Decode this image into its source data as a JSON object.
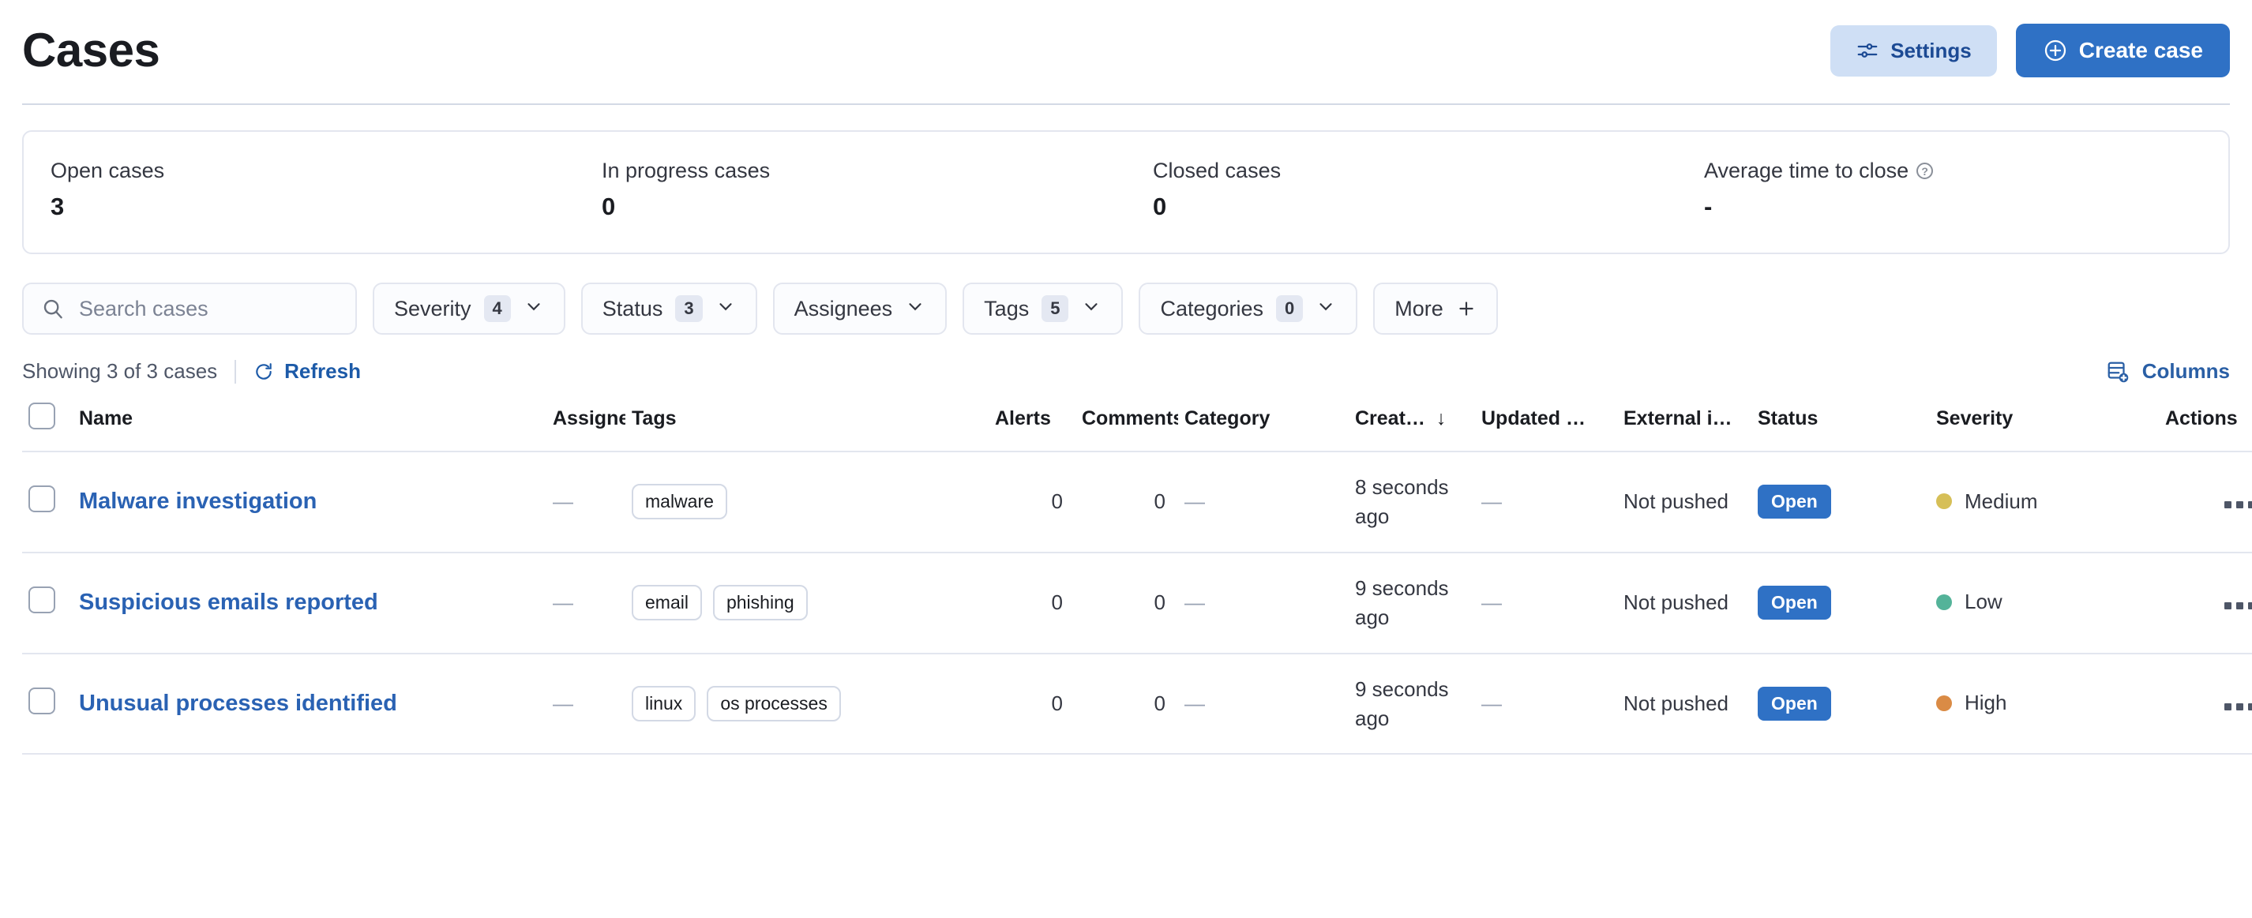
{
  "header": {
    "title": "Cases",
    "settings_label": "Settings",
    "create_label": "Create case",
    "settings_icon": "sliders-icon",
    "create_icon": "plus-circle-icon"
  },
  "stats": [
    {
      "label": "Open cases",
      "value": "3"
    },
    {
      "label": "In progress cases",
      "value": "0"
    },
    {
      "label": "Closed cases",
      "value": "0"
    },
    {
      "label": "Average time to close",
      "value": "-",
      "help": "?"
    }
  ],
  "filters": {
    "search_placeholder": "Search cases",
    "search_value": "",
    "search_icon": "search-icon",
    "buttons": [
      {
        "label": "Severity",
        "count": "4",
        "icon": "chevron-down-icon"
      },
      {
        "label": "Status",
        "count": "3",
        "icon": "chevron-down-icon"
      },
      {
        "label": "Assignees",
        "count": null,
        "icon": "chevron-down-icon"
      },
      {
        "label": "Tags",
        "count": "5",
        "icon": "chevron-down-icon"
      },
      {
        "label": "Categories",
        "count": "0",
        "icon": "chevron-down-icon"
      },
      {
        "label": "More",
        "count": null,
        "icon": "plus-icon"
      }
    ]
  },
  "toolbar": {
    "showing": "Showing 3 of 3 cases",
    "refresh_label": "Refresh",
    "refresh_icon": "refresh-icon",
    "columns_label": "Columns",
    "columns_icon": "table-add-icon"
  },
  "table": {
    "columns": [
      "Name",
      "Assignees",
      "Tags",
      "Alerts",
      "Comments",
      "Category",
      "Creat…",
      "Updated …",
      "External i…",
      "Status",
      "Severity",
      "Actions"
    ],
    "sort": {
      "column": "Creat…",
      "direction": "↓"
    },
    "rows": [
      {
        "name": "Malware investigation",
        "assignees": "—",
        "tags": [
          "malware"
        ],
        "alerts": "0",
        "comments": "0",
        "category": "—",
        "created": "8 seconds ago",
        "updated": "—",
        "external": "Not pushed",
        "status": "Open",
        "severity": "Medium",
        "severity_color": "#d6bf57"
      },
      {
        "name": "Suspicious emails reported",
        "assignees": "—",
        "tags": [
          "email",
          "phishing"
        ],
        "alerts": "0",
        "comments": "0",
        "category": "—",
        "created": "9 seconds ago",
        "updated": "—",
        "external": "Not pushed",
        "status": "Open",
        "severity": "Low",
        "severity_color": "#54b399"
      },
      {
        "name": "Unusual processes identified",
        "assignees": "—",
        "tags": [
          "linux",
          "os processes"
        ],
        "alerts": "0",
        "comments": "0",
        "category": "—",
        "created": "9 seconds ago",
        "updated": "—",
        "external": "Not pushed",
        "status": "Open",
        "severity": "High",
        "severity_color": "#da8b45"
      }
    ]
  },
  "colors": {
    "primary": "#2f71c5",
    "link": "#2a62b3",
    "settings_bg": "#cfdff5",
    "border": "#e3e6ef"
  }
}
